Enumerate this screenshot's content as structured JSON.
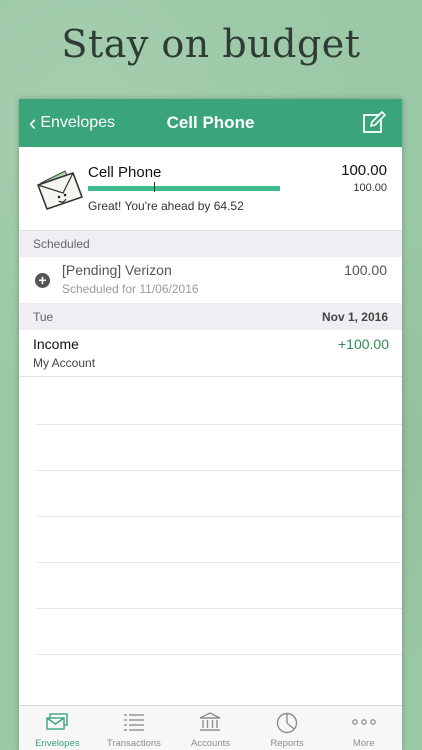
{
  "headline": "Stay on budget",
  "navbar": {
    "back_label": "Envelopes",
    "title": "Cell Phone"
  },
  "envelope_summary": {
    "name": "Cell Phone",
    "balance": "100.00",
    "budget": "100.00",
    "status_text": "Great! You're ahead by 64.52",
    "progress_fraction": 1.0,
    "progress_color": "#3dbb8c"
  },
  "scheduled_section": {
    "header": "Scheduled",
    "items": [
      {
        "name": "[Pending] Verizon",
        "subtitle": "Scheduled for 11/06/2016",
        "amount": "100.00"
      }
    ]
  },
  "transactions_section": {
    "day": "Tue",
    "date": "Nov 1, 2016",
    "items": [
      {
        "name": "Income",
        "account": "My Account",
        "amount": "+100.00",
        "amount_color": "#2f8a55"
      }
    ]
  },
  "tabbar": {
    "tabs": [
      {
        "label": "Envelopes",
        "icon": "envelopes-icon",
        "active": true
      },
      {
        "label": "Transactions",
        "icon": "transactions-icon",
        "active": false
      },
      {
        "label": "Accounts",
        "icon": "bank-icon",
        "active": false
      },
      {
        "label": "Reports",
        "icon": "reports-icon",
        "active": false
      },
      {
        "label": "More",
        "icon": "more-icon",
        "active": false
      }
    ]
  },
  "colors": {
    "accent": "#3aa57a",
    "background": "#9bc8a6"
  }
}
